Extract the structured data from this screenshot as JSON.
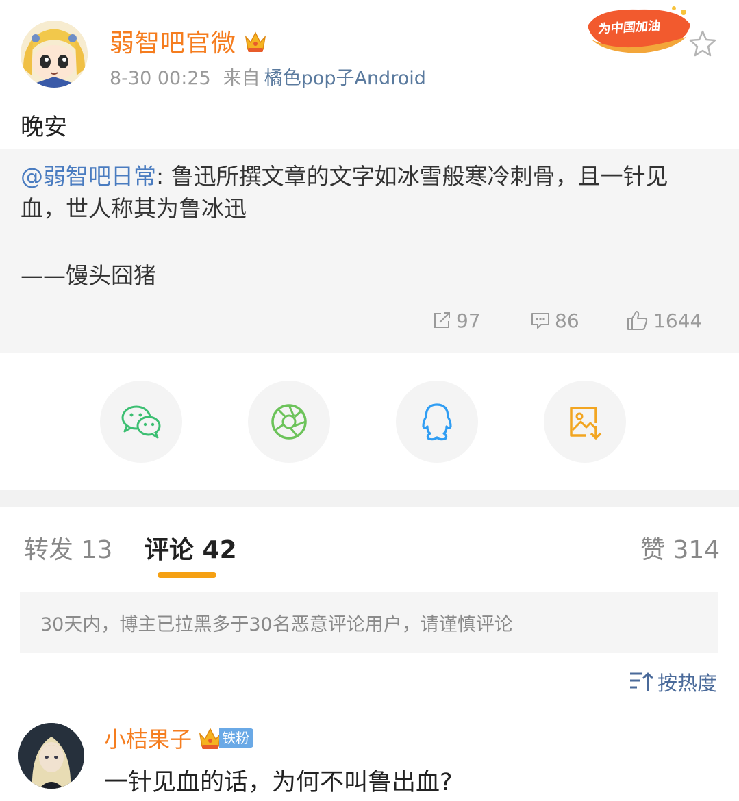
{
  "post": {
    "username": "弱智吧官微",
    "timestamp": "8-30 00:25",
    "source_prefix": "来自",
    "source": "橘色pop子Android",
    "promo_badge_text": "为中国加油",
    "text": "晚安",
    "badge_icon": "crown-badge-icon",
    "star_icon": "star-icon"
  },
  "repost": {
    "mention": "@弱智吧日常",
    "separator": ": ",
    "body": "鲁迅所撰文章的文字如冰雪般寒冷刺骨，且一针见血，世人称其为鲁冰迅",
    "signature": "——馒头囧猪",
    "stats": {
      "shares": "97",
      "comments": "86",
      "likes": "1644"
    }
  },
  "share_buttons": [
    {
      "name": "wechat",
      "icon": "wechat-icon",
      "color": "#3cbf72"
    },
    {
      "name": "moments",
      "icon": "moments-icon",
      "color": "#6cc35a"
    },
    {
      "name": "qq",
      "icon": "qq-icon",
      "color": "#2f9df3"
    },
    {
      "name": "save-image",
      "icon": "save-image-icon",
      "color": "#f2a521"
    }
  ],
  "tabs": {
    "repost": "转发 13",
    "comments": "评论 42",
    "likes": "赞 314",
    "active": "comments",
    "accent": "#f5a013"
  },
  "notice": "30天内，博主已拉黑多于30名恶意评论用户，请谨慎评论",
  "sort": {
    "label": "按热度",
    "icon": "sort-icon"
  },
  "comments": [
    {
      "username": "小桔果子",
      "fan_badge": "铁粉",
      "text": "一针见血的话，为何不叫鲁出血?"
    }
  ],
  "colors": {
    "username": "#f57d1f",
    "link": "#4a7cc0",
    "source": "#5a7a9e",
    "muted": "#9a9a9a"
  }
}
